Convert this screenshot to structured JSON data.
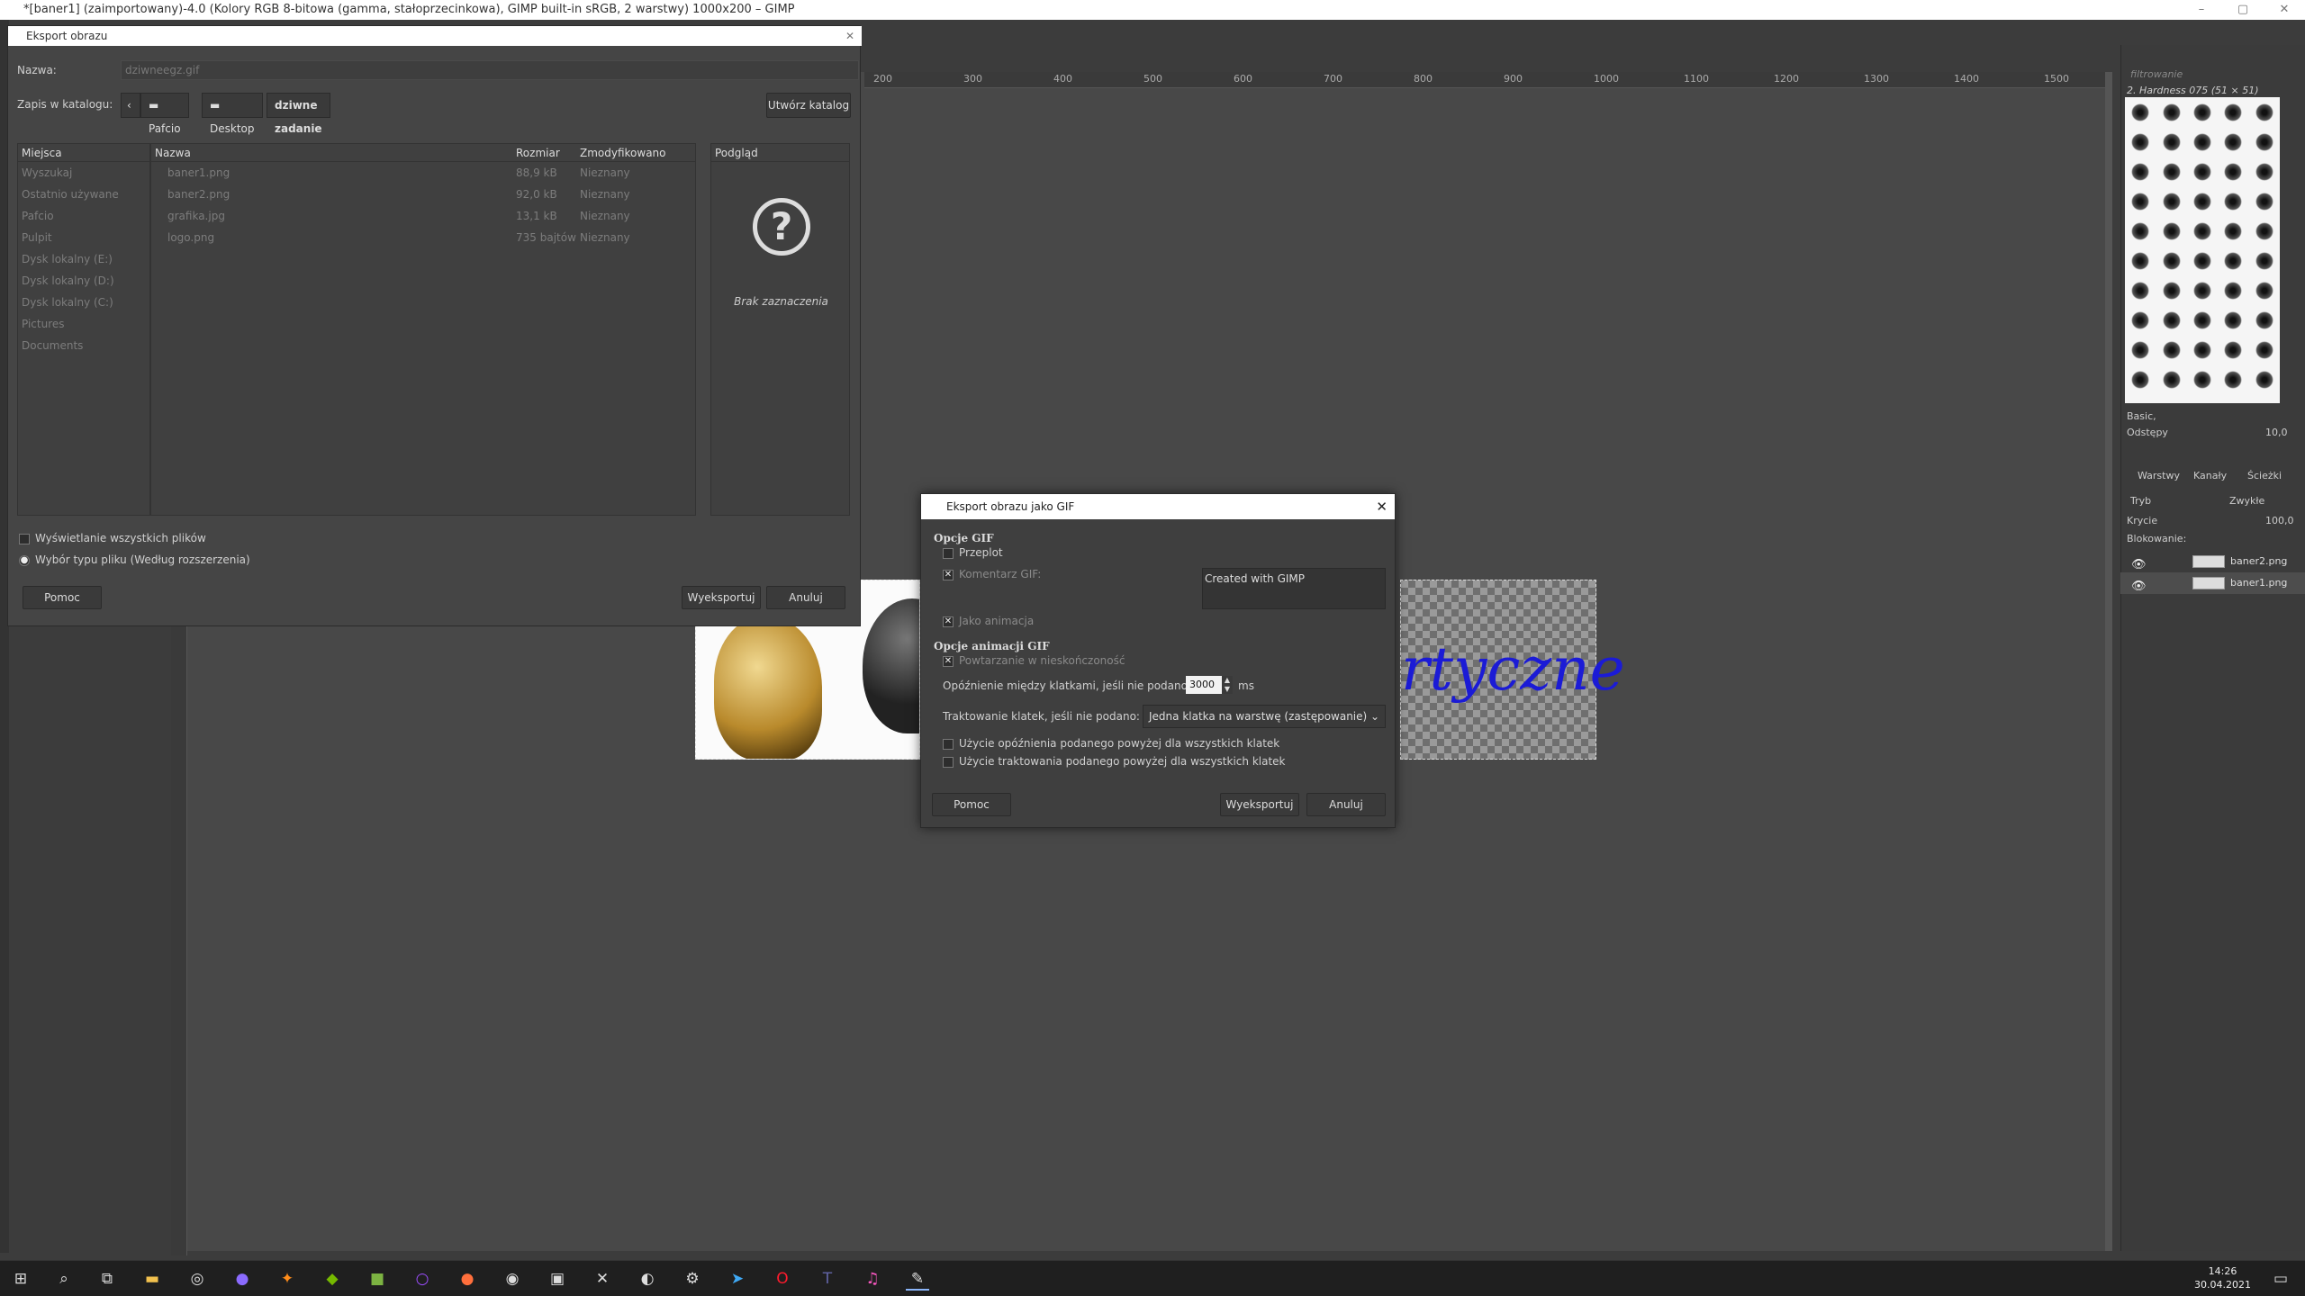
{
  "window": {
    "title": "*[baner1] (zaimportowany)-4.0 (Kolory RGB 8-bitowa (gamma, stałoprzecinkowa), GIMP built-in sRGB, 2 warstwy) 1000x200 – GIMP"
  },
  "ruler": {
    "ticks": [
      "200",
      "300",
      "400",
      "500",
      "600",
      "700",
      "800",
      "900",
      "1000",
      "1100",
      "1200",
      "1300",
      "1400",
      "1500"
    ]
  },
  "canvas": {
    "text_fragment": "rtyczne"
  },
  "export_dialog": {
    "title": "Eksport obrazu",
    "name_label": "Nazwa:",
    "name_value": "dziwneegz.gif",
    "folder_label": "Zapis w katalogu:",
    "breadcrumbs": [
      "Pafcio",
      "Desktop",
      "dziwne zadanie egz"
    ],
    "create_folder": "Utwórz katalog",
    "places_header": "Miejsca",
    "places": [
      "Wyszukaj",
      "Ostatnio używane",
      "Pafcio",
      "Pulpit",
      "Dysk lokalny (E:)",
      "Dysk lokalny (D:)",
      "Dysk lokalny (C:)",
      "Pictures",
      "Documents"
    ],
    "columns": {
      "name": "Nazwa",
      "size": "Rozmiar",
      "modified": "Zmodyfikowano"
    },
    "files": [
      {
        "name": "baner1.png",
        "size": "88,9 kB",
        "modified": "Nieznany"
      },
      {
        "name": "baner2.png",
        "size": "92,0 kB",
        "modified": "Nieznany"
      },
      {
        "name": "grafika.jpg",
        "size": "13,1 kB",
        "modified": "Nieznany"
      },
      {
        "name": "logo.png",
        "size": "735 bajtów",
        "modified": "Nieznany"
      }
    ],
    "preview_header": "Podgląd",
    "preview_empty": "Brak zaznaczenia",
    "show_all_files": "Wyświetlanie wszystkich plików",
    "file_type": "Wybór typu pliku (Według rozszerzenia)",
    "help": "Pomoc",
    "export": "Wyeksportuj",
    "cancel": "Anuluj"
  },
  "gif_dialog": {
    "title": "Eksport obrazu jako GIF",
    "section_gif": "Opcje GIF",
    "interlace": "Przeplot",
    "comment_label": "Komentarz GIF:",
    "comment_value": "Created with GIMP",
    "as_animation": "Jako animacja",
    "section_anim": "Opcje animacji GIF",
    "loop_forever": "Powtarzanie w nieskończoność",
    "delay_label": "Opóźnienie między klatkami, jeśli nie podano:",
    "delay_value": "3000",
    "delay_unit": "ms",
    "disposal_label": "Traktowanie klatek, jeśli nie podano:",
    "disposal_value": "Jedna klatka na warstwę (zastępowanie)",
    "use_delay_all": "Użycie opóźnienia podanego powyżej dla wszystkich klatek",
    "use_disposal_all": "Użycie traktowania podanego powyżej dla wszystkich klatek",
    "help": "Pomoc",
    "export": "Wyeksportuj",
    "cancel": "Anuluj"
  },
  "right_dock": {
    "filter": "filtrowanie",
    "brush_name": "2. Hardness 075 (51 × 51)",
    "brush_set": "Basic,",
    "spacing_label": "Odstępy",
    "spacing_value": "10,0",
    "tabs": [
      "Warstwy",
      "Kanały",
      "Ścieżki"
    ],
    "mode_label": "Tryb",
    "mode_value": "Zwykłe",
    "opacity_label": "Krycie",
    "opacity_value": "100,0",
    "lock_label": "Blokowanie:",
    "layers": [
      "baner2.png",
      "baner1.png"
    ]
  },
  "taskbar": {
    "time": "14:26",
    "date": "30.04.2021"
  }
}
